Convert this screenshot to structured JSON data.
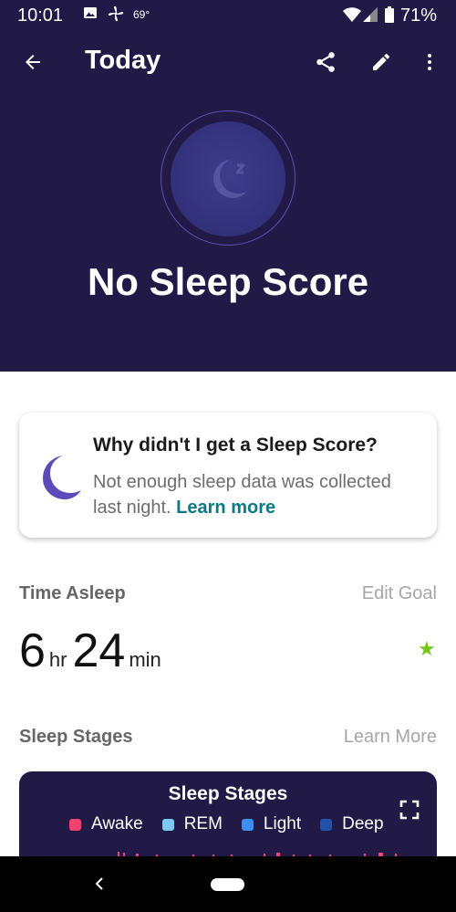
{
  "status_bar": {
    "time": "10:01",
    "temperature": "69°",
    "battery": "71%",
    "icons": [
      "image-icon",
      "fan-icon",
      "wifi-icon",
      "signal-icon",
      "battery-icon"
    ]
  },
  "toolbar": {
    "title": "Today",
    "icons": [
      "back-arrow-icon",
      "share-icon",
      "edit-pencil-icon",
      "more-vert-icon"
    ]
  },
  "score": {
    "title": "No Sleep Score",
    "icon": "sleeping-moon-icon"
  },
  "info_card": {
    "title": "Why didn't I get a Sleep Score?",
    "body": "Not enough sleep data was collected last night.",
    "link": "Learn more",
    "icon": "crescent-moon-icon"
  },
  "time_asleep": {
    "label": "Time Asleep",
    "edit_goal": "Edit Goal",
    "hours": "6",
    "hours_unit": "hr",
    "minutes": "24",
    "minutes_unit": "min",
    "goal_icon": "star-icon"
  },
  "sleep_stages": {
    "label": "Sleep Stages",
    "learn_more": "Learn More",
    "card_title": "Sleep Stages",
    "legend": [
      {
        "label": "Awake",
        "color": "#f0436e"
      },
      {
        "label": "REM",
        "color": "#7ec8f7"
      },
      {
        "label": "Light",
        "color": "#3d8ef0"
      },
      {
        "label": "Deep",
        "color": "#2451a8"
      }
    ],
    "expand_icon": "fullscreen-icon"
  },
  "colors": {
    "header_bg": "#211a47",
    "accent_link": "#0a7a84",
    "moon_purple": "#5b4ab8",
    "star_green": "#77c61a"
  },
  "nav_bar": {
    "icons": [
      "nav-back-icon",
      "home-pill-icon"
    ]
  }
}
